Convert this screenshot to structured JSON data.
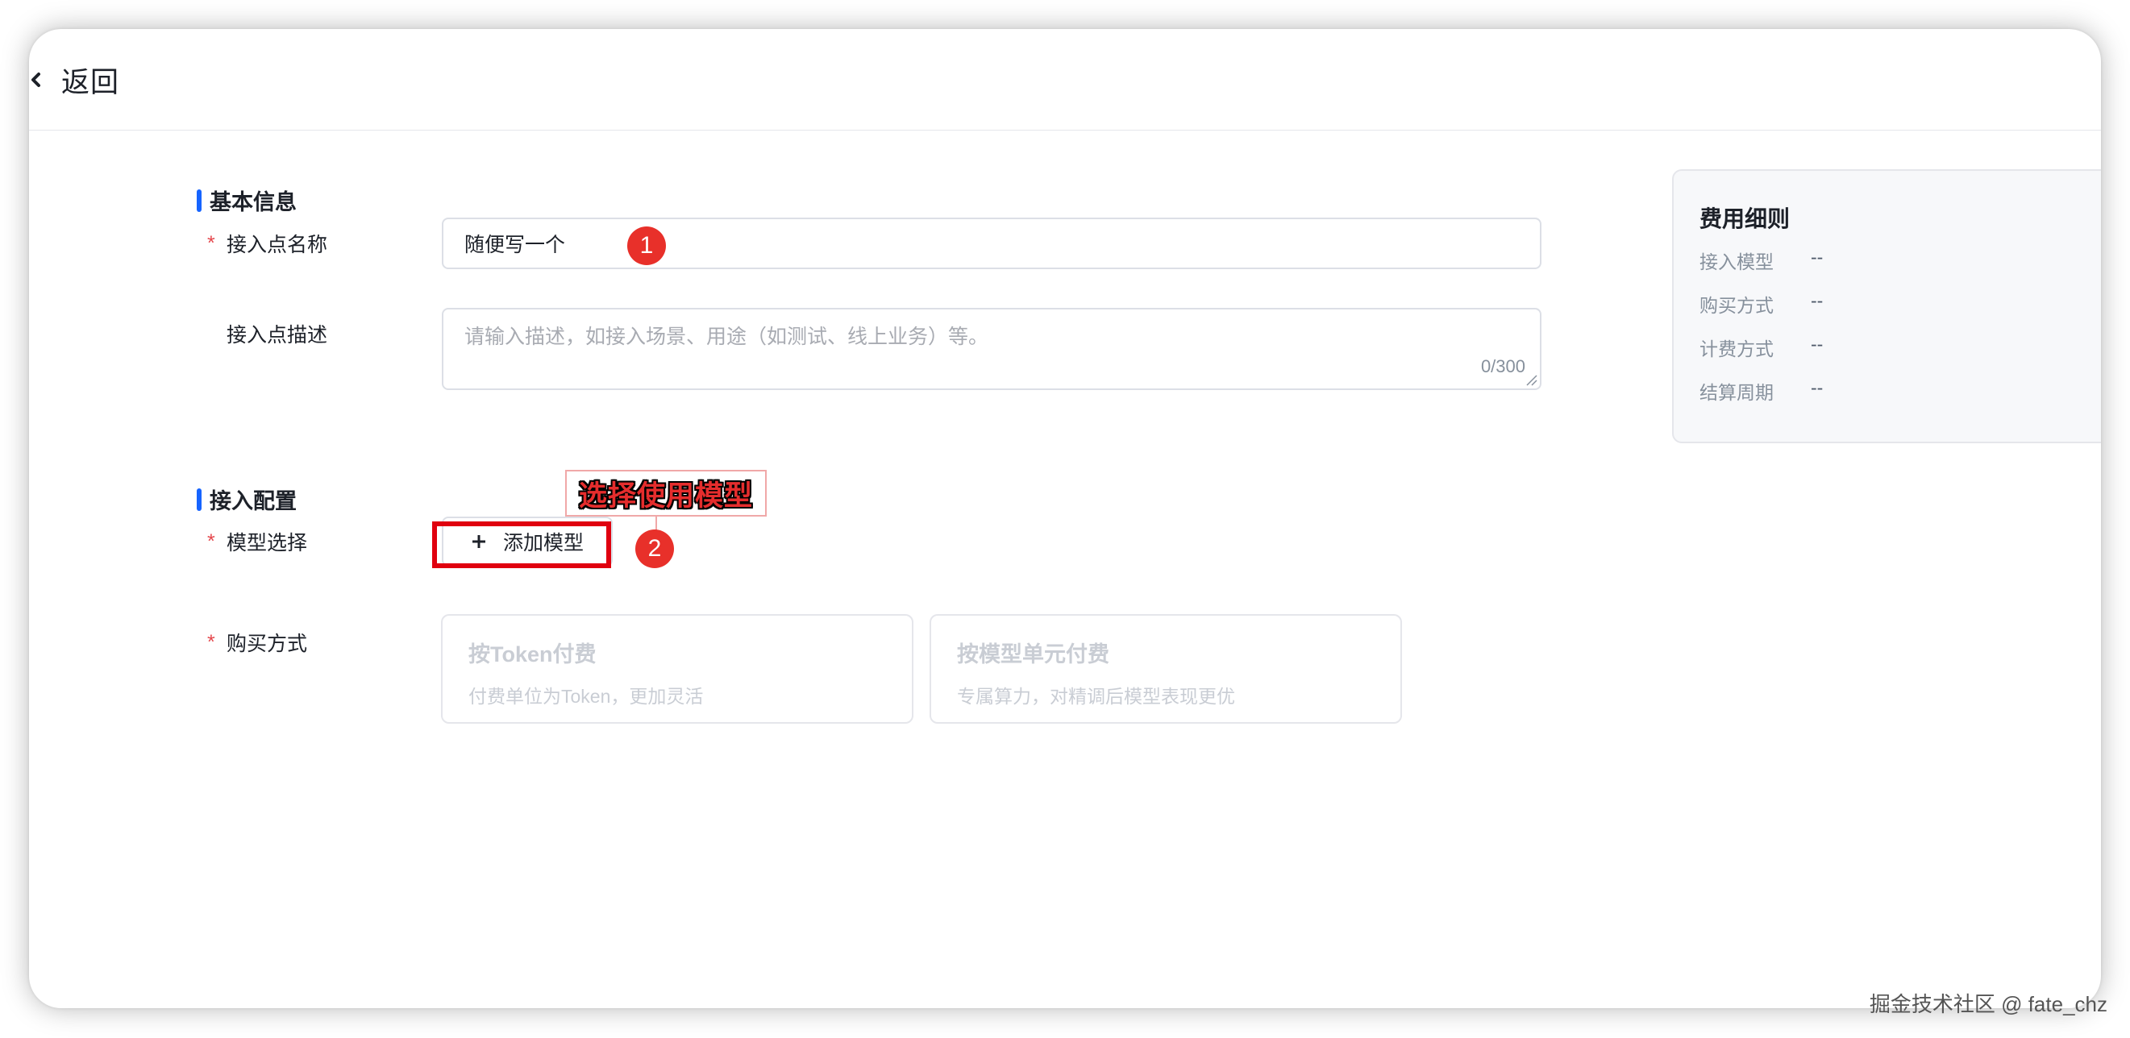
{
  "header": {
    "back_label": "返回"
  },
  "basic_info": {
    "section_title": "基本信息",
    "name_label": "接入点名称",
    "name_value": "随便写一个",
    "desc_label": "接入点描述",
    "desc_placeholder": "请输入描述，如接入场景、用途（如测试、线上业务）等。",
    "desc_counter": "0/300"
  },
  "access_config": {
    "section_title": "接入配置",
    "model_label": "模型选择",
    "add_model_label": "添加模型",
    "purchase_label": "购买方式",
    "purchase_options": [
      {
        "title": "按Token付费",
        "desc": "付费单位为Token，更加灵活"
      },
      {
        "title": "按模型单元付费",
        "desc": "专属算力，对精调后模型表现更优"
      }
    ]
  },
  "annotations": {
    "step1": "1",
    "step2": "2",
    "callout": "选择使用模型",
    "highlight_color": "#e0000f"
  },
  "fee_panel": {
    "title": "费用细则",
    "rows": [
      {
        "label": "接入模型",
        "value": "--"
      },
      {
        "label": "购买方式",
        "value": "--"
      },
      {
        "label": "计费方式",
        "value": "--"
      },
      {
        "label": "结算周期",
        "value": "--"
      }
    ]
  },
  "colors": {
    "accent": "#1664ff",
    "required": "#e5484d",
    "annotation": "#e8302a"
  },
  "watermark": "掘金技术社区 @ fate_chz"
}
